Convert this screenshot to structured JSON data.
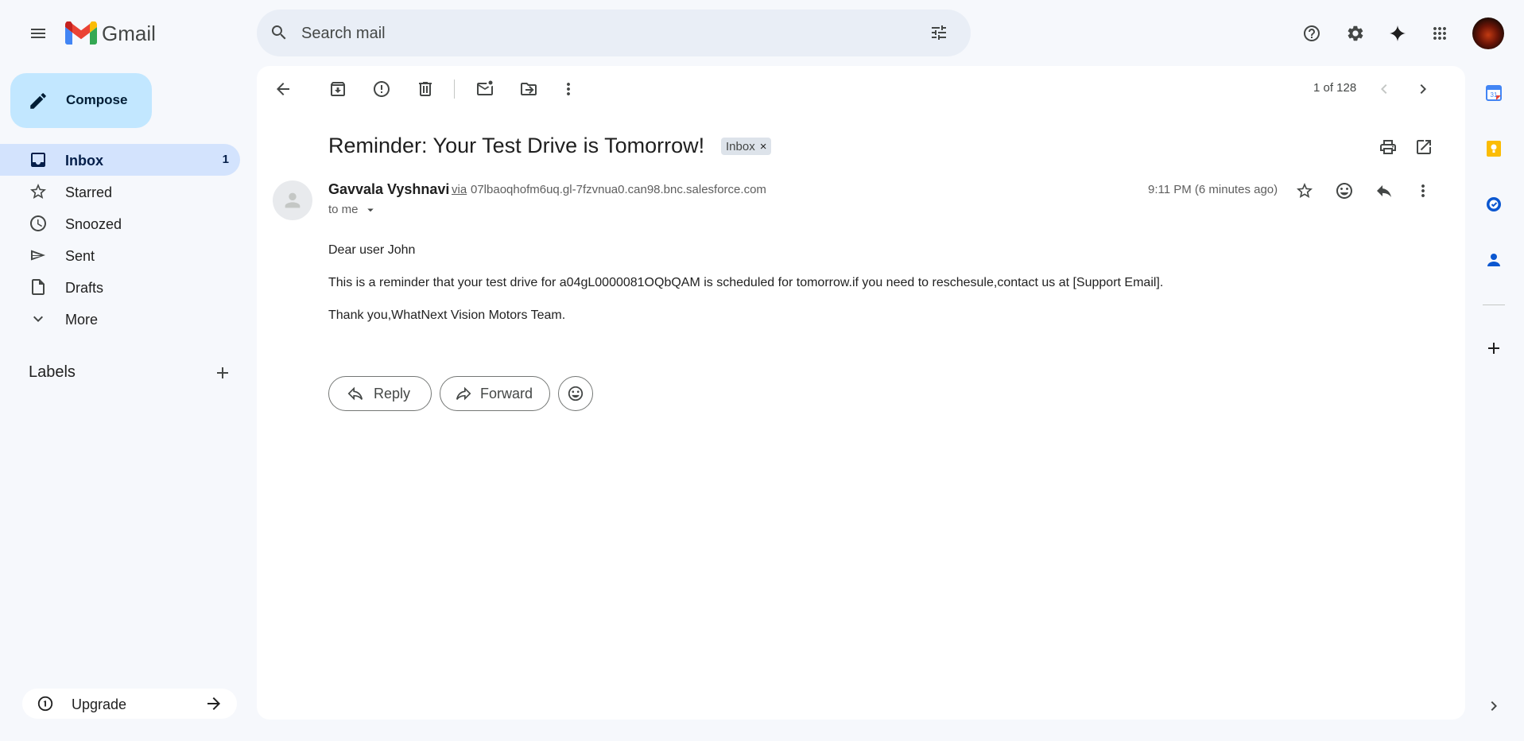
{
  "app": {
    "name": "Gmail",
    "search_placeholder": "Search mail"
  },
  "sidebar": {
    "compose_label": "Compose",
    "items": [
      {
        "label": "Inbox",
        "count": "1"
      },
      {
        "label": "Starred"
      },
      {
        "label": "Snoozed"
      },
      {
        "label": "Sent"
      },
      {
        "label": "Drafts"
      },
      {
        "label": "More"
      }
    ],
    "labels_heading": "Labels",
    "upgrade_label": "Upgrade"
  },
  "toolbar": {
    "pager": "1 of 128"
  },
  "email": {
    "subject": "Reminder: Your Test Drive is Tomorrow!",
    "label_chip": "Inbox",
    "label_chip_close": "×",
    "sender_name": "Gavvala Vyshnavi",
    "via": "via",
    "sender_address": "07lbaoqhofm6uq.gl-7fzvnua0.can98.bnc.salesforce.com",
    "to": "to me",
    "time": "9:11 PM (6 minutes ago)",
    "body": [
      "Dear user John",
      "This is a reminder that your test drive for a04gL0000081OQbQAM is scheduled for tomorrow.if you need to reschesule,contact us at [Support Email].",
      "Thank you,WhatNext Vision Motors Team."
    ],
    "reply_label": "Reply",
    "forward_label": "Forward"
  },
  "colors": {
    "background": "#f6f8fc",
    "compose": "#c2e7ff",
    "active_nav": "#d3e3fd",
    "search_bg": "#e9eef6"
  }
}
